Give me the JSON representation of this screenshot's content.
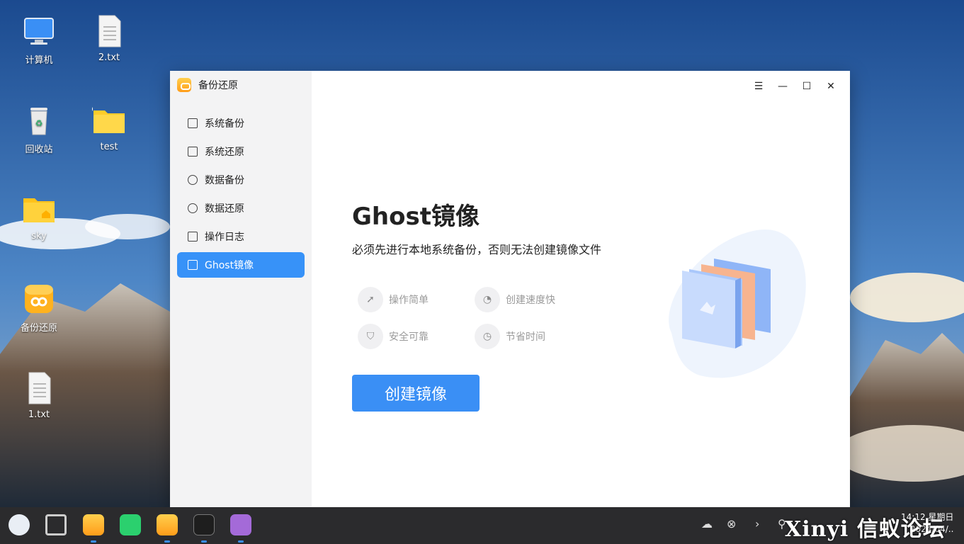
{
  "desktop": {
    "icons": [
      {
        "label": "计算机",
        "icon": "computer-icon"
      },
      {
        "label": "2.txt",
        "icon": "text-file-icon"
      },
      {
        "label": "回收站",
        "icon": "trash-icon"
      },
      {
        "label": "test",
        "icon": "folder-icon"
      },
      {
        "label": "sky",
        "icon": "home-folder-icon"
      },
      {
        "label": "备份还原",
        "icon": "backup-restore-app-icon"
      },
      {
        "label": "1.txt",
        "icon": "text-file-icon"
      }
    ]
  },
  "window": {
    "app_title": "备份还原",
    "nav": [
      {
        "label": "系统备份",
        "icon": "system-backup-icon"
      },
      {
        "label": "系统还原",
        "icon": "system-restore-icon"
      },
      {
        "label": "数据备份",
        "icon": "data-backup-icon"
      },
      {
        "label": "数据还原",
        "icon": "data-restore-icon"
      },
      {
        "label": "操作日志",
        "icon": "log-icon"
      },
      {
        "label": "Ghost镜像",
        "icon": "ghost-image-icon",
        "active": true
      }
    ],
    "titlebar": {
      "menu": "☰",
      "minimize": "—",
      "maximize": "☐",
      "close": "✕"
    },
    "main": {
      "title": "Ghost镜像",
      "subtitle": "必须先进行本地系统备份，否则无法创建镜像文件",
      "features": [
        {
          "label": "操作简单",
          "icon": "pointer-icon"
        },
        {
          "label": "创建速度快",
          "icon": "speedometer-icon"
        },
        {
          "label": "安全可靠",
          "icon": "shield-icon"
        },
        {
          "label": "节省时间",
          "icon": "clock-icon"
        }
      ],
      "primary_button": "创建镜像"
    }
  },
  "taskbar": {
    "clock_time": "14:12 星期日",
    "clock_date": "2024/04/..",
    "watermark": "Xinyi 信蚁论坛"
  },
  "colors": {
    "accent": "#3792f8",
    "sidebar_bg": "#f3f3f4",
    "taskbar_bg": "#2b2b2d"
  }
}
